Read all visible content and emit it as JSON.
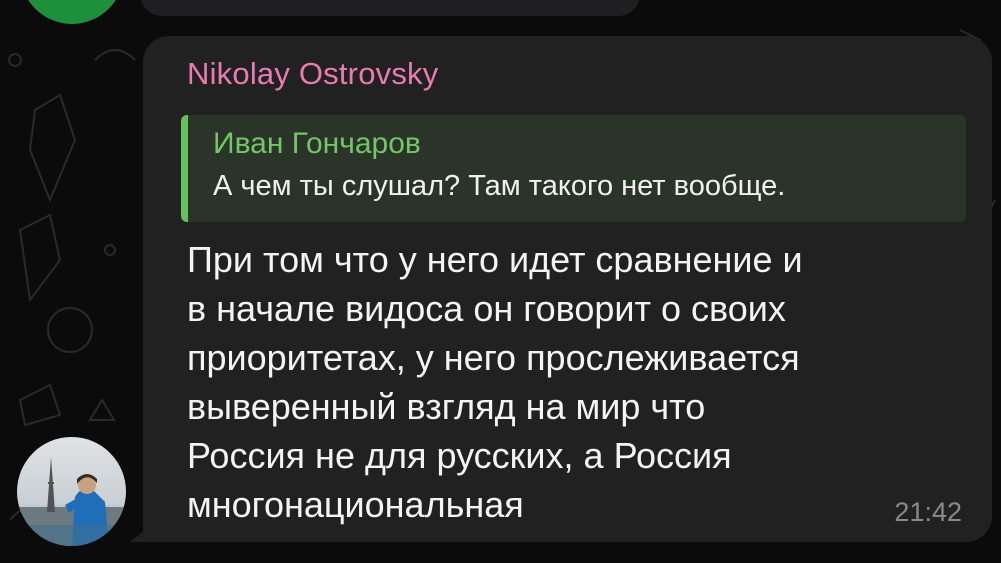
{
  "message": {
    "sender_name": "Nikolay Ostrovsky",
    "reply": {
      "author": "Иван Гончаров",
      "text": "А чем ты слушал? Там такого нет вообще."
    },
    "text": "При том что у него идет сравнение и\nв начале видоса он говорит о своих\nприоритетах, у него прослеживается\nвыверенный взгляд на мир что\nРоссия не для русских, а Россия\nмногонациональная",
    "time": "21:42"
  },
  "colors": {
    "background": "#0b0b0c",
    "bubble": "#212122",
    "sender_name": "#e87bb0",
    "reply_bar": "#65c15a",
    "reply_author": "#73c667",
    "timestamp": "#8a8a8c"
  }
}
